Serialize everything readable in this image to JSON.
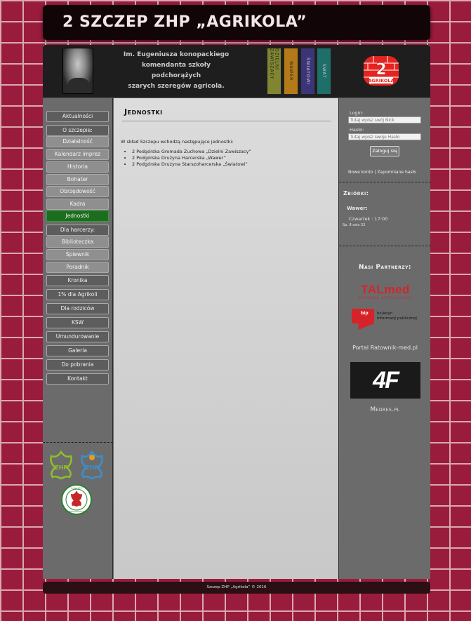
{
  "site_title": "2 SZCZEP ZHP „AGRIKOLA”",
  "header": {
    "motto_line1": "Im. Eugeniusza konopackiego",
    "motto_line2": "komendanta szkoły podchorążych",
    "motto_line3": "szarych szeregów agricola.",
    "banners": [
      "DZIELNI ZAWISZACY",
      "WAWER",
      "ŚWIATOWI",
      "SWAT"
    ],
    "logo_number": "2",
    "logo_text": "AGRIKOLA"
  },
  "nav": {
    "items": [
      {
        "label": "Aktualności",
        "style": "dark"
      },
      {
        "label": "O szczepie:",
        "style": "dark"
      },
      {
        "label": "Działalność",
        "style": "sub"
      },
      {
        "label": "Kalendarz imprez",
        "style": "sub"
      },
      {
        "label": "Historia",
        "style": "sub"
      },
      {
        "label": "Bohater",
        "style": "sub"
      },
      {
        "label": "Obrzędowość",
        "style": "sub"
      },
      {
        "label": "Kadra",
        "style": "sub"
      },
      {
        "label": "Jednostki",
        "style": "active"
      },
      {
        "label": "Dla harcerzy:",
        "style": "dark"
      },
      {
        "label": "Biblioteczka",
        "style": "sub"
      },
      {
        "label": "Śpiewnik",
        "style": "sub"
      },
      {
        "label": "Poradnik",
        "style": "sub"
      },
      {
        "label": "Kronika",
        "style": "dark"
      },
      {
        "label": "1% dla Agrikoli",
        "style": "dark"
      },
      {
        "label": "Dla rodziców",
        "style": "dark"
      },
      {
        "label": "KSW",
        "style": "dark"
      },
      {
        "label": "Umundurowanie",
        "style": "dark"
      },
      {
        "label": "Galeria",
        "style": "dark"
      },
      {
        "label": "Do pobrania",
        "style": "dark"
      },
      {
        "label": "Kontakt",
        "style": "dark"
      }
    ]
  },
  "main": {
    "heading": "Jednostki",
    "intro": "W skład Szczepu wchodzą następujące jednostki:",
    "units": [
      "2 Podgórska Gromada Zuchowa „Dzielni Zawiszacy”",
      "2 Podgórska Drużyna Harcerska „Wawer”",
      "2 Podgórska Drużyna Starszoharcerska „Światowi”"
    ]
  },
  "login": {
    "login_label": "Login:",
    "login_placeholder": "Tutaj wpisz swój Nick",
    "password_label": "Hasło:",
    "password_placeholder": "Tutaj wpisz swoje Hasło",
    "submit_label": "Zaloguj się",
    "new_account": "Nowe konto",
    "separator": "|",
    "forgot_password": "Zapomniane hasło"
  },
  "zbiorki": {
    "heading": "Zbiórki:",
    "team": "Wawer:",
    "time": "Czwartek : 17:00",
    "place": "Sp. 8 sala 32"
  },
  "partners": {
    "heading": "Nasi Partnerzy:",
    "talmed": "TALmed",
    "talmed_sub": "OŚRODEK KSZTAŁCENIA",
    "bip_line1": "biuletyn",
    "bip_line2": "informacji publicznej",
    "bip_logo": "bip",
    "portal": "Portal Ratownik-med.pl",
    "brand_4f": "4F",
    "medres": "Medres.pl"
  },
  "left_logos": {
    "badge_text_top": "Hufiec ZHP",
    "badge_text_bottom": "KRAKÓW PODGÓRZE"
  },
  "footer": "Szczep ZHP „Agrikola” © 2016",
  "colors": {
    "background": "#9a1c3c",
    "active_nav": "#1c6e1e",
    "talmed_red": "#d6232a",
    "logo_red": "#e52420"
  }
}
